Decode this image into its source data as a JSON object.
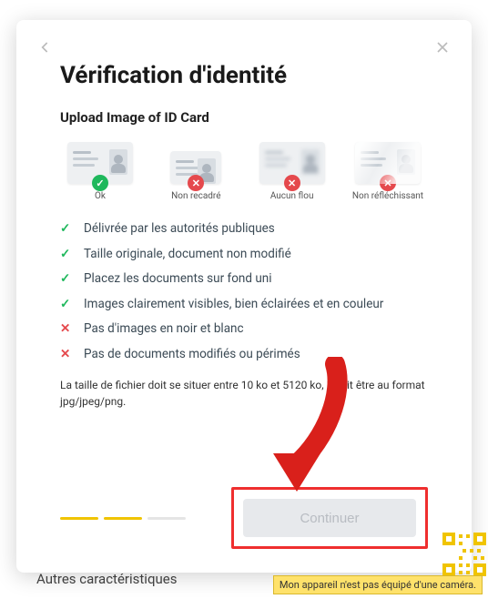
{
  "bg": {
    "footerText": "Autres caractéristiques"
  },
  "modal": {
    "title": "Vérification d'identité",
    "subtitle": "Upload Image of ID Card",
    "examples": [
      {
        "label": "Ok",
        "status": "ok",
        "variant": "ok"
      },
      {
        "label": "Non recadré",
        "status": "bad",
        "variant": "crop"
      },
      {
        "label": "Aucun flou",
        "status": "bad",
        "variant": "blur"
      },
      {
        "label": "Non réfléchissant",
        "status": "bad",
        "variant": "reflect"
      }
    ],
    "rules": [
      {
        "ok": true,
        "text": "Délivrée par les autorités publiques"
      },
      {
        "ok": true,
        "text": "Taille originale, document non modifié"
      },
      {
        "ok": true,
        "text": "Placez les documents sur fond uni"
      },
      {
        "ok": true,
        "text": "Images clairement visibles, bien éclairées et en couleur"
      },
      {
        "ok": false,
        "text": "Pas d'images en noir et blanc"
      },
      {
        "ok": false,
        "text": "Pas de documents modifiés ou périmés"
      }
    ],
    "fileNote": "La taille de fichier doit se situer entre 10 ko et 5120 ko, il doit être au format jpg/jpeg/png.",
    "continueLabel": "Continuer"
  },
  "cameraWarning": "Mon appareil n'est pas équipé d'une caméra."
}
